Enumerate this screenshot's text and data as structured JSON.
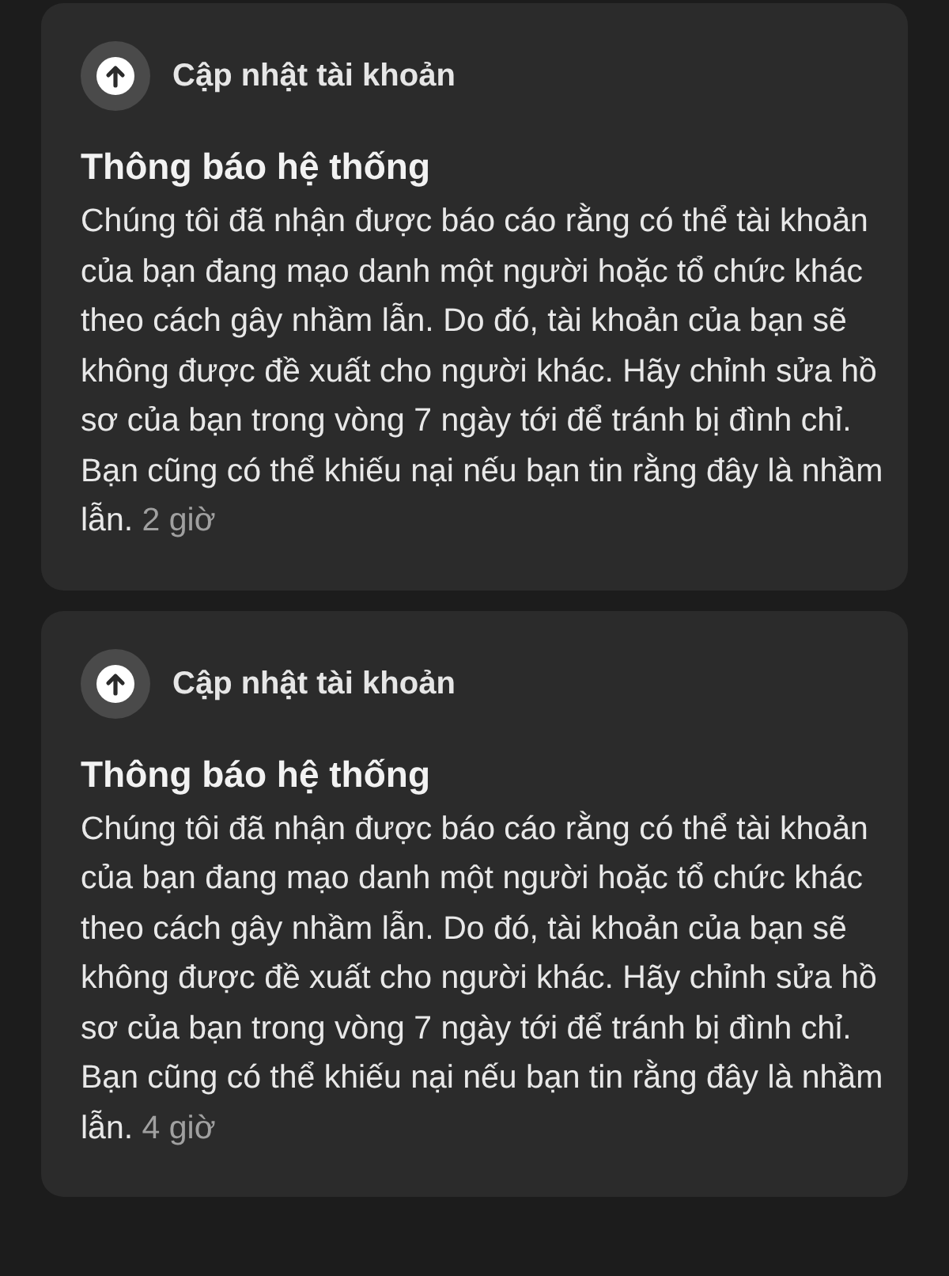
{
  "notifications": [
    {
      "header": "Cập nhật tài khoản",
      "title": "Thông báo hệ thống",
      "message": "Chúng tôi đã nhận được báo cáo rằng có thể tài khoản của bạn đang mạo danh một người hoặc tổ chức khác theo cách gây nhầm lẫn. Do đó, tài khoản của bạn sẽ không được đề xuất cho người khác. Hãy chỉnh sửa hồ sơ của bạn trong vòng 7 ngày tới để tránh bị đình chỉ. Bạn cũng có thể khiếu nại nếu bạn tin rằng đây là nhầm lẫn.",
      "time": "2 giờ"
    },
    {
      "header": "Cập nhật tài khoản",
      "title": "Thông báo hệ thống",
      "message": "Chúng tôi đã nhận được báo cáo rằng có thể tài khoản của bạn đang mạo danh một người hoặc tổ chức khác theo cách gây nhầm lẫn. Do đó, tài khoản của bạn sẽ không được đề xuất cho người khác. Hãy chỉnh sửa hồ sơ của bạn trong vòng 7 ngày tới để tránh bị đình chỉ. Bạn cũng có thể khiếu nại nếu bạn tin rằng đây là nhầm lẫn.",
      "time": "4 giờ"
    }
  ]
}
